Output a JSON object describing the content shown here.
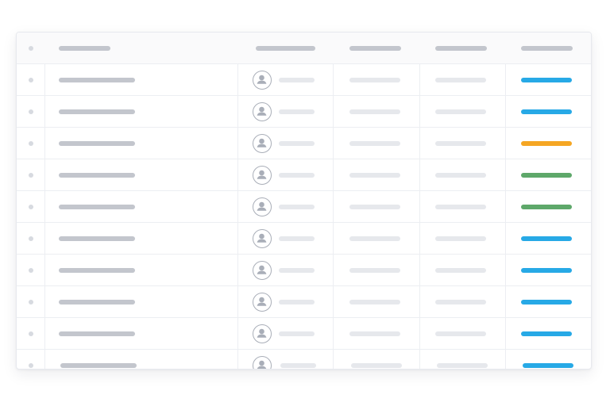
{
  "colors": {
    "status_blue": "#27a9e6",
    "status_orange": "#f5a623",
    "status_green": "#5ea86a",
    "header_bar": "#c3c6cd",
    "row_name_bar": "#c3c6cd",
    "row_placeholder_bar": "#e6e8ec",
    "grid_line": "#eceef2"
  },
  "icons": {
    "row_marker": "dot-icon",
    "assignee": "user-avatar-icon"
  },
  "table": {
    "columns": [
      "select",
      "name",
      "assignee",
      "col-3",
      "col-4",
      "status"
    ],
    "rows": [
      {
        "status_color": "#27a9e6"
      },
      {
        "status_color": "#27a9e6"
      },
      {
        "status_color": "#f5a623"
      },
      {
        "status_color": "#5ea86a"
      },
      {
        "status_color": "#5ea86a"
      },
      {
        "status_color": "#27a9e6"
      },
      {
        "status_color": "#27a9e6"
      },
      {
        "status_color": "#27a9e6"
      },
      {
        "status_color": "#27a9e6"
      },
      {
        "status_color": "#27a9e6"
      }
    ]
  }
}
